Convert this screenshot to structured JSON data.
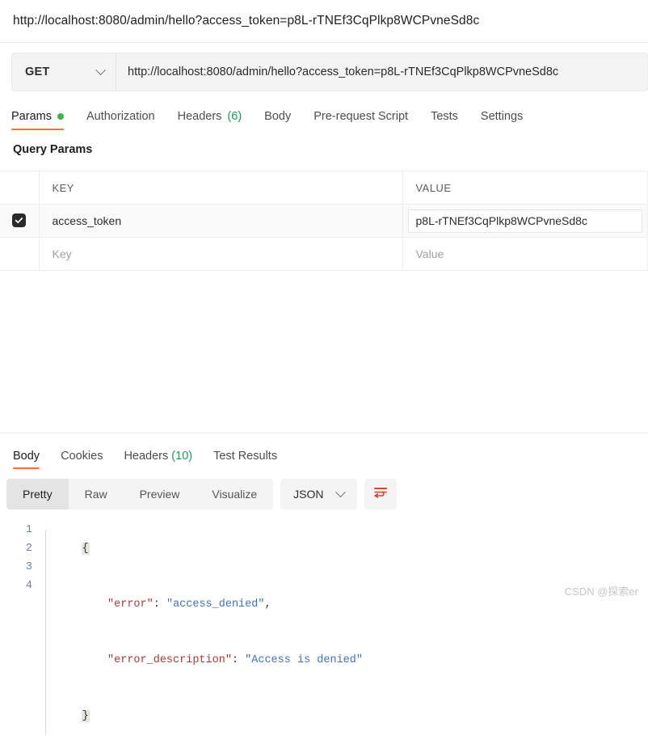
{
  "header": {
    "title": "http://localhost:8080/admin/hello?access_token=p8L-rTNEf3CqPlkp8WCPvneSd8c"
  },
  "request": {
    "method": "GET",
    "url": "http://localhost:8080/admin/hello?access_token=p8L-rTNEf3CqPlkp8WCPvneSd8c",
    "tabs": [
      {
        "label": "Params",
        "has_dot": true,
        "active": true
      },
      {
        "label": "Authorization",
        "active": false
      },
      {
        "label": "Headers",
        "count": "(6)",
        "active": false
      },
      {
        "label": "Body",
        "active": false
      },
      {
        "label": "Pre-request Script",
        "active": false
      },
      {
        "label": "Tests",
        "active": false
      },
      {
        "label": "Settings",
        "active": false
      }
    ],
    "section_heading": "Query Params",
    "table": {
      "columns": [
        "KEY",
        "VALUE"
      ],
      "rows": [
        {
          "checked": true,
          "key": "access_token",
          "value": "p8L-rTNEf3CqPlkp8WCPvneSd8c"
        }
      ],
      "empty_row": {
        "key_placeholder": "Key",
        "value_placeholder": "Value"
      }
    }
  },
  "response": {
    "tabs": [
      {
        "label": "Body",
        "active": true
      },
      {
        "label": "Cookies",
        "active": false
      },
      {
        "label": "Headers",
        "count": "(10)",
        "active": false
      },
      {
        "label": "Test Results",
        "active": false
      }
    ],
    "view_modes": [
      {
        "label": "Pretty",
        "active": true
      },
      {
        "label": "Raw",
        "active": false
      },
      {
        "label": "Preview",
        "active": false
      },
      {
        "label": "Visualize",
        "active": false
      }
    ],
    "language": "JSON",
    "body_lines": [
      {
        "num": "1",
        "type": "brace",
        "text": "{"
      },
      {
        "num": "2",
        "type": "pair",
        "key": "\"error\"",
        "sep": ": ",
        "value": "\"access_denied\"",
        "tail": ","
      },
      {
        "num": "3",
        "type": "pair",
        "key": "\"error_description\"",
        "sep": ": ",
        "value": "\"Access is denied\"",
        "tail": ""
      },
      {
        "num": "4",
        "type": "brace",
        "text": "}"
      }
    ]
  },
  "watermark": "CSDN @探索er",
  "colors": {
    "accent": "#ff6c37",
    "dot_green": "#3cb54a",
    "count_green": "#14a05a",
    "json_key": "#b03636",
    "json_string": "#3f72c1"
  }
}
